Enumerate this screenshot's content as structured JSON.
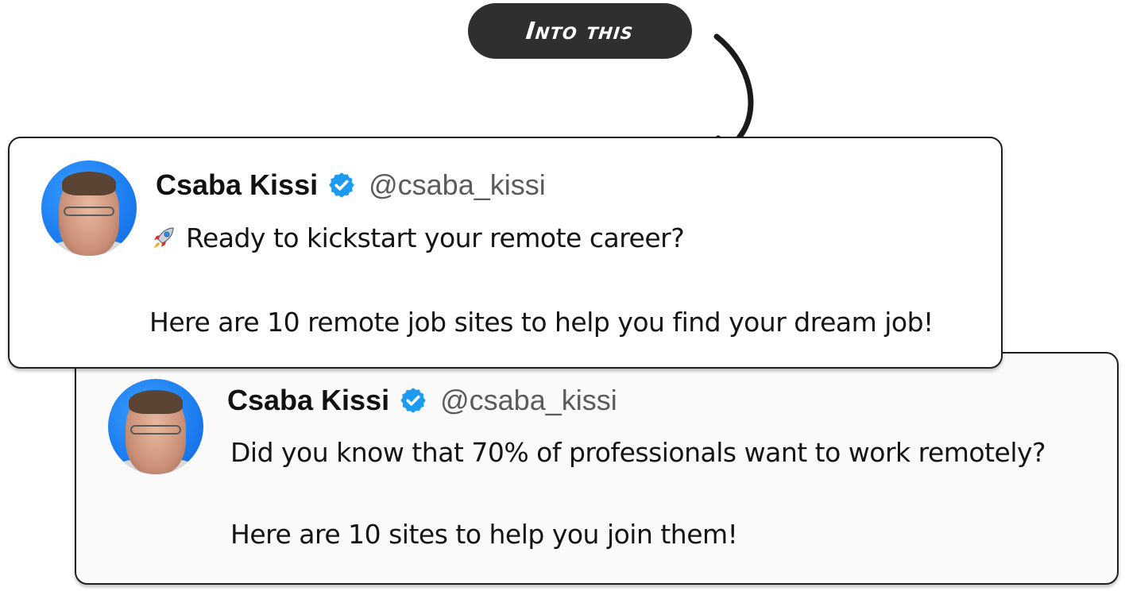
{
  "header": {
    "pill_label": "Into this"
  },
  "colors": {
    "pill_background": "#2f2f2f",
    "verified_blue": "#1d9bf0",
    "card_border": "#1f1f1f"
  },
  "tweets": [
    {
      "name": "Csaba Kissi",
      "handle": "@csaba_kissi",
      "emoji": "rocket-icon",
      "line1": "Ready to kickstart your remote career?",
      "line2": "Here are 10 remote job sites to help you find your dream job!"
    },
    {
      "name": "Csaba Kissi",
      "handle": "@csaba_kissi",
      "line1": "Did you know that 70% of professionals want to work remotely?",
      "line2": "Here are 10 sites to help you join them!"
    }
  ],
  "icons": {
    "arrow": "curved-arrow-icon",
    "verified": "verified-badge-icon",
    "avatar": "profile-photo"
  }
}
